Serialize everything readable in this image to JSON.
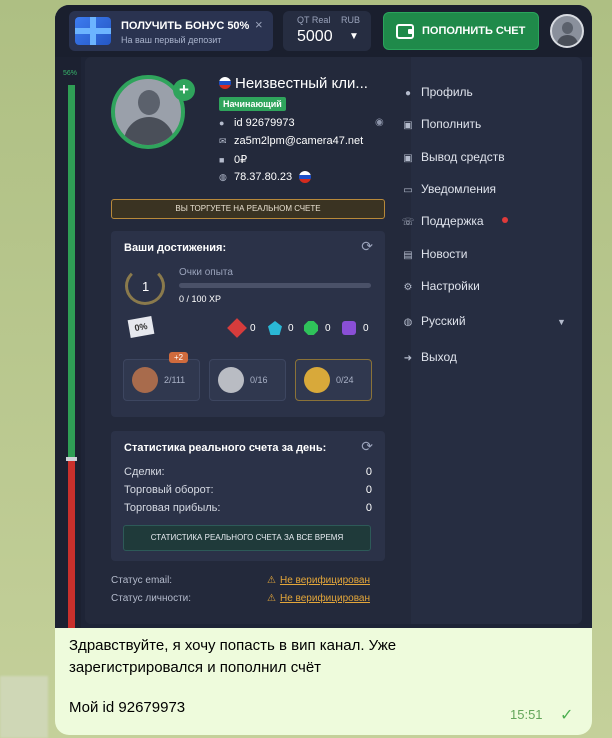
{
  "topbar": {
    "bonus_title": "ПОЛУЧИТЬ БОНУС 50%",
    "bonus_subtitle": "На ваш первый депозит",
    "bonus_close": "×",
    "account_type": "QT Real",
    "account_currency": "RUB",
    "balance": "5000",
    "topup_label": "ПОПОЛНИТЬ СЧЕТ"
  },
  "sidebar": {
    "percent": "56%",
    "level_fraction": 0.56
  },
  "profile": {
    "name": "Неизвестный кли...",
    "level": "Начинающий",
    "id": "id 92679973",
    "email": "za5m2lpm@camera47.net",
    "balance": "0₽",
    "ip": "78.37.80.23",
    "real_account_label": "ВЫ ТОРГУЕТЕ НА РЕАЛЬНОМ СЧЕТЕ"
  },
  "achievements": {
    "title": "Ваши достижения:",
    "level": "1",
    "xp_label": "Очки опыта",
    "xp_value": "0 / 100 XP",
    "xp_fraction": 0,
    "gems": [
      "0",
      "0",
      "0",
      "0"
    ],
    "medals": [
      {
        "label": "2/111",
        "badge": "+2"
      },
      {
        "label": "0/16"
      },
      {
        "label": "0/24"
      }
    ]
  },
  "daily_stats": {
    "title": "Статистика реального счета за день:",
    "rows": [
      {
        "label": "Сделки:",
        "value": "0"
      },
      {
        "label": "Торговый оборот:",
        "value": "0"
      },
      {
        "label": "Торговая прибыль:",
        "value": "0"
      }
    ],
    "all_time_button": "СТАТИСТИКА РЕАЛЬНОГО СЧЕТА ЗА ВСЕ ВРЕМЯ"
  },
  "status": {
    "email_label": "Статус email:",
    "email_value": "Не верифицирован",
    "identity_label": "Статус личности:",
    "identity_value": "Не верифицирован"
  },
  "menu": [
    {
      "label": "Профиль",
      "icon": "user-icon"
    },
    {
      "label": "Пополнить",
      "icon": "deposit-icon"
    },
    {
      "label": "Вывод средств",
      "icon": "withdraw-icon"
    },
    {
      "label": "Уведомления",
      "icon": "inbox-icon"
    },
    {
      "label": "Поддержка",
      "icon": "support-icon"
    },
    {
      "label": "Новости",
      "icon": "news-icon"
    },
    {
      "label": "Настройки",
      "icon": "gear-icon"
    },
    {
      "label": "Русский",
      "icon": "globe-icon"
    },
    {
      "label": "Выход",
      "icon": "logout-icon"
    }
  ],
  "message": {
    "text": "Здравствуйте, я хочу попасть в вип канал. Уже зарегистрировался и пополнил счёт",
    "id_line": "Мой id 92679973",
    "time": "15:51"
  },
  "colors": {
    "accent_green": "#2fa45c",
    "warning": "#e3a63a",
    "danger": "#c9302c"
  }
}
